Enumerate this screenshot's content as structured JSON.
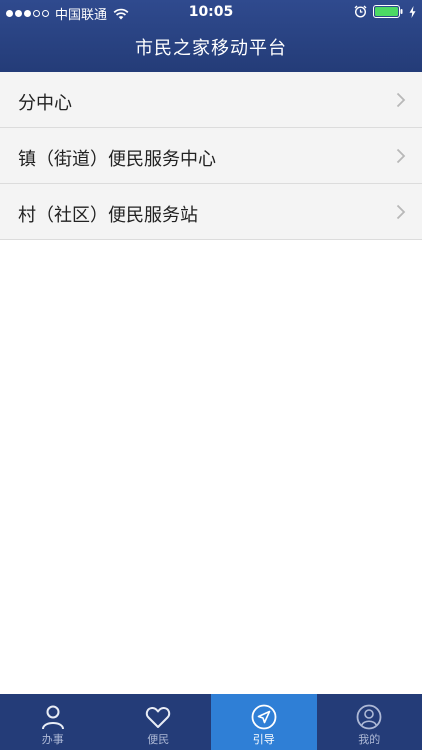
{
  "status_bar": {
    "carrier": "中国联通",
    "time": "10:05",
    "signal_icon": "signal-dots-icon",
    "wifi_icon": "wifi-icon",
    "alarm_icon": "alarm-icon",
    "battery_icon": "battery-icon",
    "charging_icon": "charging-icon"
  },
  "header": {
    "title": "市民之家移动平台",
    "background": "#243c78"
  },
  "list": {
    "items": [
      {
        "label": "分中心",
        "icon": "chevron-right-icon"
      },
      {
        "label": "镇（街道）便民服务中心",
        "icon": "chevron-right-icon"
      },
      {
        "label": "村（社区）便民服务站",
        "icon": "chevron-right-icon"
      }
    ]
  },
  "tab_bar": {
    "tabs": [
      {
        "label": "办事",
        "icon": "person-icon",
        "active": false
      },
      {
        "label": "便民",
        "icon": "heart-icon",
        "active": false
      },
      {
        "label": "引导",
        "icon": "navigation-arrow-icon",
        "active": true
      },
      {
        "label": "我的",
        "icon": "user-profile-icon",
        "active": false
      }
    ],
    "active_color": "#2f7fd6",
    "inactive_color": "#aeb9d6"
  }
}
